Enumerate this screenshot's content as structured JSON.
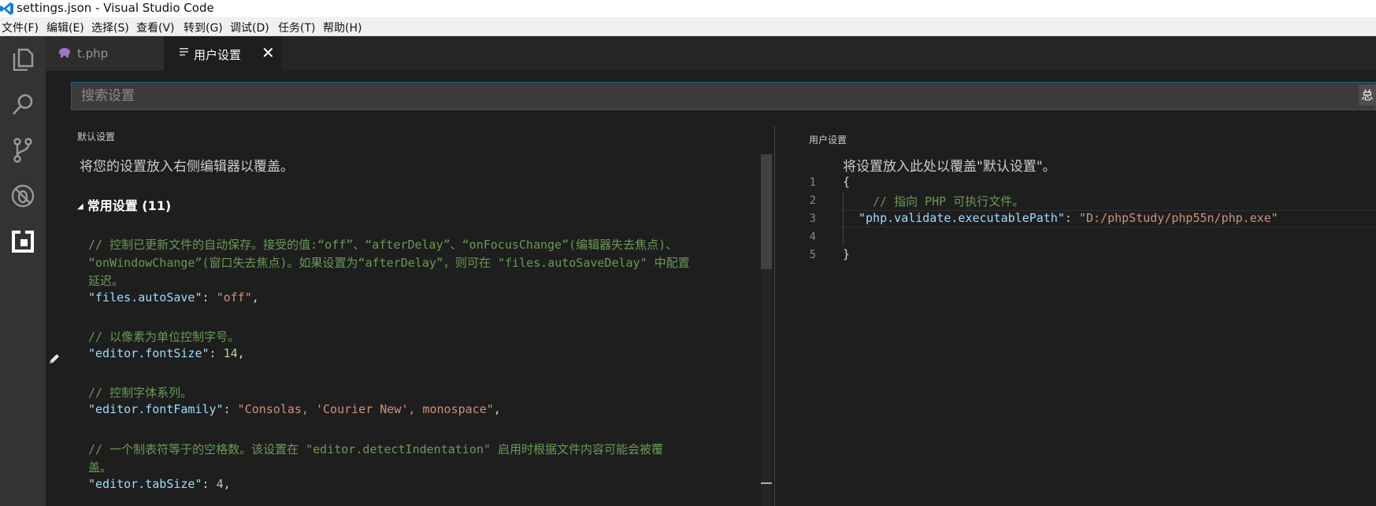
{
  "window": {
    "title": "settings.json - Visual Studio Code"
  },
  "menu": [
    "文件(F)",
    "编辑(E)",
    "选择(S)",
    "查看(V)",
    "转到(G)",
    "调试(D)",
    "任务(T)",
    "帮助(H)"
  ],
  "activity_bar": {
    "icons": [
      "explorer-icon",
      "search-icon",
      "source-control-icon",
      "debug-icon",
      "extensions-icon"
    ]
  },
  "tabs": [
    {
      "label": "t.php",
      "icon": "php-elephant-icon"
    },
    {
      "label": "用户设置",
      "icon": "settings-file-icon",
      "close": "✕"
    }
  ],
  "search": {
    "placeholder": "搜索设置",
    "count_badge": "总"
  },
  "default_settings": {
    "header": "默认设置",
    "description": "将您的设置放入右侧编辑器以覆盖。",
    "group_arrow": "◢",
    "group_title": "常用设置 (11)",
    "lines": [
      {
        "type": "comment",
        "text": "// 控制已更新文件的自动保存。接受的值:“off”、“afterDelay”、“onFocusChange”(编辑器失去焦点)、"
      },
      {
        "type": "comment",
        "text": "“onWindowChange”(窗口失去焦点)。如果设置为“afterDelay”，则可在 \"files.autoSaveDelay\" 中配置"
      },
      {
        "type": "comment",
        "text": "延迟。"
      },
      {
        "type": "setting",
        "key": "\"files.autoSave\"",
        "value": "\"off\"",
        "value_kind": "str"
      },
      {
        "type": "comment",
        "text": "// 以像素为单位控制字号。"
      },
      {
        "type": "setting",
        "key": "\"editor.fontSize\"",
        "value": "14",
        "value_kind": "num"
      },
      {
        "type": "comment",
        "text": "// 控制字体系列。"
      },
      {
        "type": "setting",
        "key": "\"editor.fontFamily\"",
        "value": "\"Consolas, 'Courier New', monospace\"",
        "value_kind": "str"
      },
      {
        "type": "comment",
        "text": "// 一个制表符等于的空格数。该设置在 \"editor.detectIndentation\" 启用时根据文件内容可能会被覆"
      },
      {
        "type": "comment",
        "text": "盖。"
      },
      {
        "type": "setting",
        "key": "\"editor.tabSize\"",
        "value": "4",
        "value_kind": "num"
      }
    ]
  },
  "user_settings": {
    "header": "用户设置",
    "description": "将设置放入此处以覆盖\"默认设置\"。",
    "line_numbers": [
      "1",
      "2",
      "3",
      "4",
      "5"
    ],
    "lines": [
      {
        "type": "punct",
        "text": "{"
      },
      {
        "type": "comment",
        "text": "// 指向 PHP 可执行文件。"
      },
      {
        "type": "setting",
        "key": "\"php.validate.executablePath\"",
        "value": "\"D:/phpStudy/php55n/php.exe\"",
        "value_kind": "str"
      },
      {
        "type": "empty",
        "text": ""
      },
      {
        "type": "punct",
        "text": "}"
      }
    ]
  },
  "colors": {
    "editor_bg": "#1e1e1e",
    "activity_bar_bg": "#333333",
    "tab_bar_bg": "#252526",
    "comment": "#6a9955",
    "key": "#9cdcfe",
    "string": "#ce9178",
    "number": "#b5cea8",
    "focus_border": "#0e639c"
  }
}
